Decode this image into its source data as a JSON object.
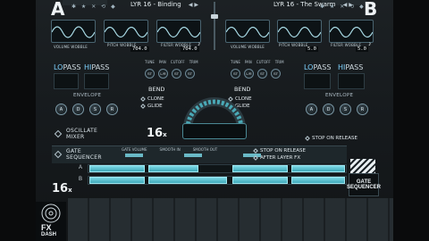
{
  "deck_a": {
    "letter": "A",
    "preset": "LYR 16 - Binding"
  },
  "deck_b": {
    "letter": "B",
    "preset": "LYR 16 - The Swarm"
  },
  "header_icons": "✱ ★  ✕ ⟲ ◆",
  "preset_arrows": "◀ ▶",
  "waveforms": [
    {
      "label": "VOLUME WOBBLE",
      "value": ""
    },
    {
      "label": "PITCH WOBBLE",
      "value": "704.0"
    },
    {
      "label": "FILTER WOBBLE",
      "value": "704.0"
    },
    {
      "label": "VOLUME WOBBLE",
      "value": ""
    },
    {
      "label": "PITCH WOBBLE",
      "value": "5.0"
    },
    {
      "label": "FILTER WOBBLE",
      "value": "5.0"
    }
  ],
  "pass": {
    "lo": "LO",
    "hi": "HI",
    "suffix": "PASS"
  },
  "envelope_label": "ENVELOPE",
  "adsr": [
    "A",
    "D",
    "S",
    "R"
  ],
  "tune_labels": [
    "TUNE",
    "PAN",
    "CUTOFF",
    "TRIM"
  ],
  "tune_knobs": [
    "ST",
    "L/R",
    "ST",
    "ST"
  ],
  "bend": "BEND",
  "clone": "CLONE",
  "glide": "GLIDE",
  "oscillate_mixer": "OSCILLATE\nMIXER",
  "osc_count": "16",
  "osc_x": "x",
  "stop_on_release": "STOP ON RELEASE",
  "gate_sequencer": "GATE\nSEQUENCER",
  "gate_cols": [
    "GATE VOLUME",
    "SMOOTH IN",
    "SMOOTH OUT"
  ],
  "gate_stop": "STOP ON RELEASE",
  "gate_after": "AFTER LAYER FX",
  "gate_rows": [
    "A",
    "B"
  ],
  "gate_count": "16",
  "gate_x": "x",
  "gate_logo_text": "GATE\nSEQUENCER",
  "fx_logo": {
    "l1": "FX",
    "l2": "DASH"
  },
  "note_icon": "♪",
  "accent": "#7dd9e6"
}
